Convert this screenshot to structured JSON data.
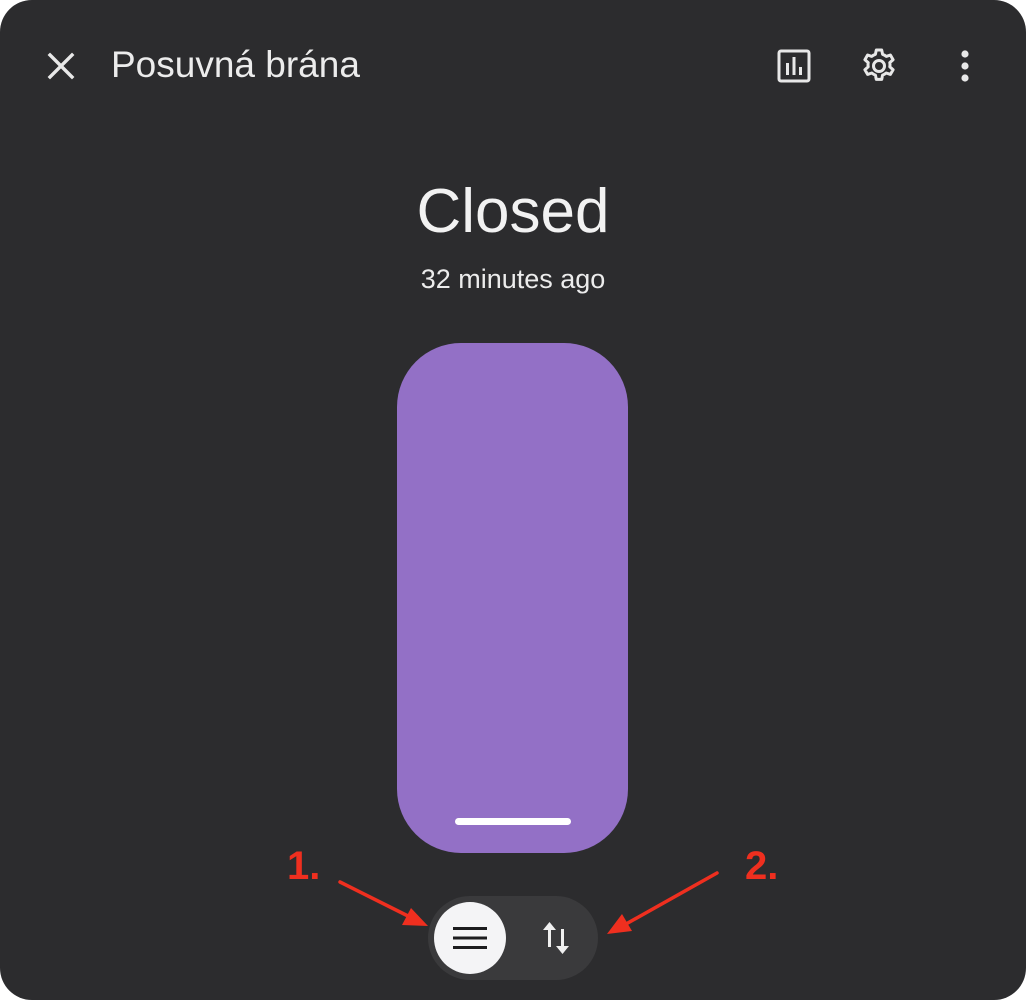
{
  "header": {
    "title": "Posuvná brána",
    "close_icon": "close-icon",
    "history_icon": "chart-box-outline-icon",
    "settings_icon": "cog-outline-icon",
    "more_icon": "dots-vertical-icon"
  },
  "entity": {
    "state": "Closed",
    "last_changed": "32 minutes ago",
    "position": 0,
    "accent_color": "#9370c6"
  },
  "mode_switch": {
    "selected": "position",
    "options": [
      {
        "id": "position",
        "icon": "menu-icon"
      },
      {
        "id": "buttons",
        "icon": "swap-vertical-arrows-icon"
      }
    ]
  },
  "annotations": [
    {
      "label": "1.",
      "color": "#ef2f1f"
    },
    {
      "label": "2.",
      "color": "#ef2f1f"
    }
  ]
}
